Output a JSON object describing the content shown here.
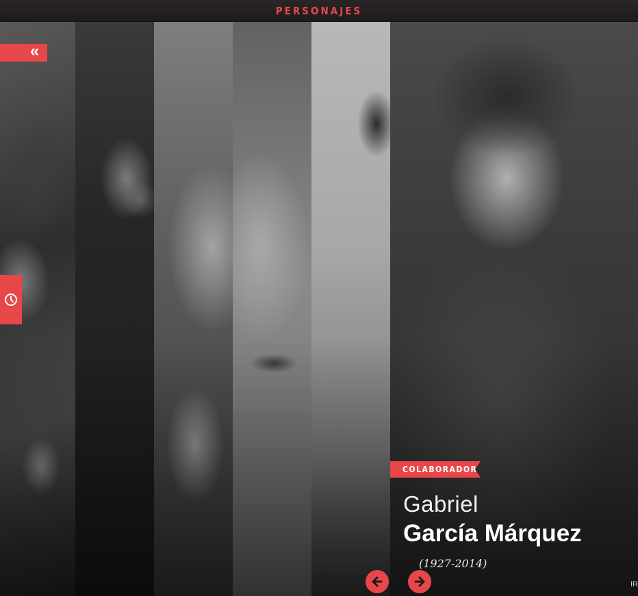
{
  "header": {
    "title": "PERSONAJES"
  },
  "controls": {
    "collapse_icon": "double-chevron-left-icon",
    "timeline_icon": "clock-icon",
    "accent": "#e8474a"
  },
  "featured": {
    "role": "COLABORADOR",
    "first_name": "Gabriel",
    "last_name": "García Márquez",
    "years": "(1927-2014)"
  },
  "navigation": {
    "prev_icon": "arrow-left-icon",
    "next_icon": "arrow-right-icon",
    "more_label": "IR"
  }
}
